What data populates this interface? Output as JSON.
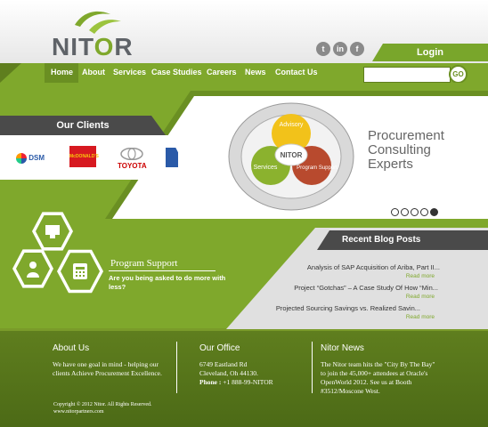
{
  "brand": {
    "name_pre": "NIT",
    "name_o": "O",
    "name_post": "R"
  },
  "social": [
    {
      "icon": "twitter-icon",
      "glyph": "t"
    },
    {
      "icon": "linkedin-icon",
      "glyph": "in"
    },
    {
      "icon": "facebook-icon",
      "glyph": "f"
    }
  ],
  "login_label": "Login",
  "nav": [
    "Home",
    "About",
    "Services",
    "Case Studies",
    "Careers",
    "News",
    "Contact Us"
  ],
  "search": {
    "placeholder": "",
    "go_label": "GO"
  },
  "slider": {
    "heading": [
      "Procurement",
      "Consulting",
      "Experts"
    ],
    "wheel_labels": [
      "Advisory",
      "Services",
      "Program Support",
      "NITOR"
    ],
    "active_dot": 4
  },
  "clients": {
    "title": "Our Clients",
    "logos": [
      "DSM",
      "McDONALD'S",
      "TOYOTA"
    ]
  },
  "blog": {
    "title": "Recent Blog Posts",
    "posts": [
      {
        "title": "Analysis of SAP Acquisition of Ariba, Part II...",
        "more": "Read more"
      },
      {
        "title": "Project “Gotchas” – A Case Study Of How “Min...",
        "more": "Read more"
      },
      {
        "title": "Projected Sourcing Savings vs. Realized Savin...",
        "more": "Read more"
      }
    ]
  },
  "program": {
    "title": "Program Support",
    "desc": "Are you being asked to do more with less?"
  },
  "footer": {
    "about_title": "About Us",
    "about_text": "We have one goal in mind - helping our clients Achieve Procurement Excellence.",
    "office_title": "Our Office",
    "office_line1": "6749 Eastland Rd",
    "office_line2": "Cleveland, Oh 44130.",
    "office_phone_label": "Phone :",
    "office_phone": "+1 888-99-NITOR",
    "news_title": "Nitor News",
    "news_text": "The Nitor team hits the \"City By The Bay\" to join the 45,000+ attendees at Oracle's OpenWorld 2012. See us at Booth #3512/Moscone West.",
    "copyright": "Copyright © 2012 Nitor. All Rights Reserved.",
    "website": "www.nitorpartners.com"
  },
  "colors": {
    "brand_green": "#7fa82c",
    "dark_green": "#5f7e1e",
    "dark_gray": "#4a4a4a"
  }
}
